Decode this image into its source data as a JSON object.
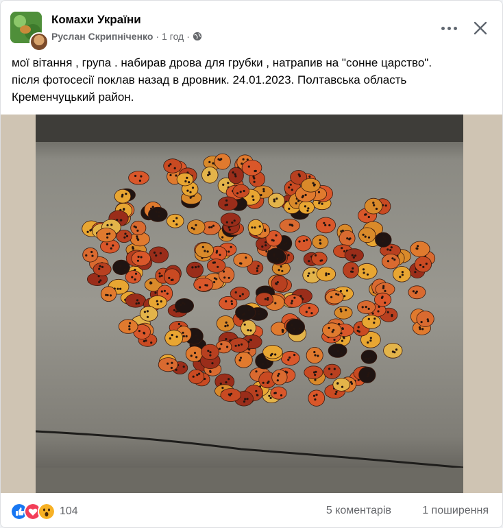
{
  "post": {
    "group_name": "Комахи України",
    "author": "Руслан Скрипніченко",
    "separator": "·",
    "time": "1 год",
    "privacy_icon": "globe-icon",
    "text_line1": "мої вітання , група . набирав дрова для грубки , натрапив на \"сонне царство\".",
    "text_line2": "після фотосесії поклав назад в дровник. 24.01.2023. Полтавська область",
    "text_line3": "Кременчуцький район."
  },
  "controls": {
    "more_icon": "more-horizontal-icon",
    "close_icon": "close-icon"
  },
  "footer": {
    "reactions": [
      "like-icon",
      "love-icon",
      "wow-icon"
    ],
    "reaction_count": "104",
    "comments": "5 коментарів",
    "shares": "1 поширення"
  },
  "colors": {
    "like": "#1877f2",
    "love": "#f33e58",
    "wow": "#f7b125",
    "secondary_text": "#65676b"
  }
}
